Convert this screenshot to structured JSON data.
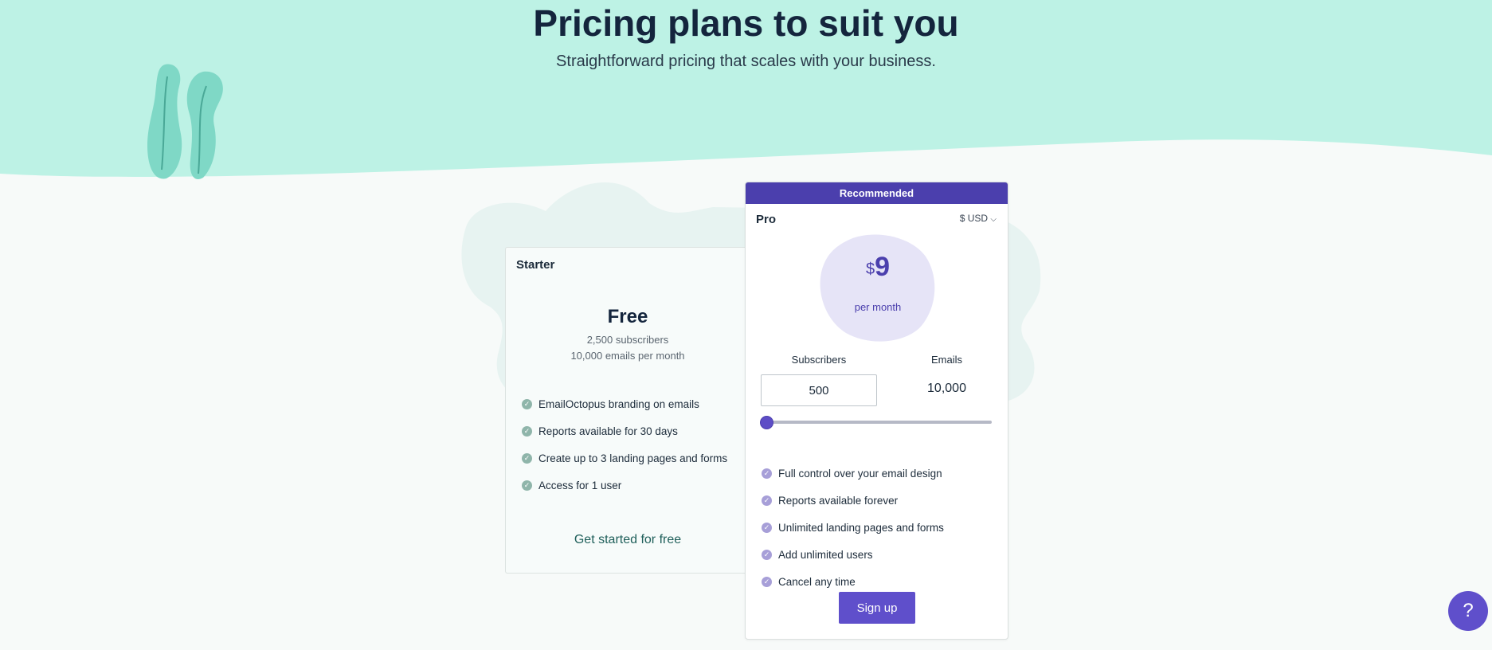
{
  "hero": {
    "title": "Pricing plans to suit you",
    "subtitle": "Straightforward pricing that scales with your business."
  },
  "colors": {
    "hero_bg": "#bdf2e5",
    "brand_purple": "#4b3fad",
    "button_purple": "#5f4fcb",
    "blob_lavender": "#e6e4f7",
    "check_green": "#8fb5aa",
    "check_purple": "#a79fd8"
  },
  "starter": {
    "name": "Starter",
    "price": "Free",
    "subscribers": "2,500 subscribers",
    "emails": "10,000 emails per month",
    "features": [
      "EmailOctopus branding on emails",
      "Reports available for 30 days",
      "Create up to 3 landing pages and forms",
      "Access for 1 user"
    ],
    "cta": "Get started for free"
  },
  "pro": {
    "badge": "Recommended",
    "name": "Pro",
    "currency": "$ USD",
    "currency_icon": "chevron-down-icon",
    "price_symbol": "$",
    "price_amount": "9",
    "price_period": "per month",
    "subscribers_label": "Subscribers",
    "emails_label": "Emails",
    "subscribers_value": "500",
    "emails_value": "10,000",
    "slider_level": 0,
    "features": [
      "Full control over your email design",
      "Reports available forever",
      "Unlimited landing pages and forms",
      "Add unlimited users",
      "Cancel any time"
    ],
    "cta": "Sign up"
  },
  "help": {
    "label": "?",
    "icon": "help-icon"
  }
}
